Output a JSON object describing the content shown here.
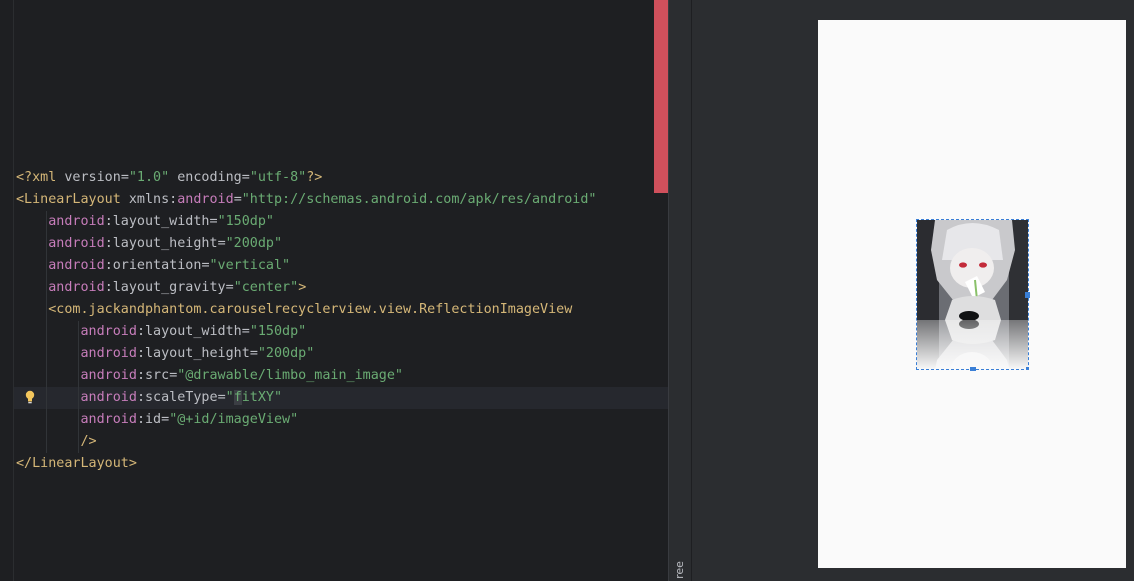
{
  "editor": {
    "lines": [
      [
        {
          "t": "<?xml ",
          "c": "tag"
        },
        {
          "t": "version",
          "c": "pl"
        },
        {
          "t": "=",
          "c": "pl"
        },
        {
          "t": "\"1.0\"",
          "c": "str"
        },
        {
          "t": " encoding",
          "c": "pl"
        },
        {
          "t": "=",
          "c": "pl"
        },
        {
          "t": "\"utf-8\"",
          "c": "str"
        },
        {
          "t": "?>",
          "c": "tag"
        }
      ],
      [
        {
          "t": "<LinearLayout ",
          "c": "tag"
        },
        {
          "t": "xmlns:",
          "c": "pl"
        },
        {
          "t": "android",
          "c": "ns"
        },
        {
          "t": "=",
          "c": "pl"
        },
        {
          "t": "\"http://schemas.android.com/apk/res/android\"",
          "c": "str"
        }
      ],
      [
        {
          "t": "    ",
          "c": "pl"
        },
        {
          "t": "android",
          "c": "ns"
        },
        {
          "t": ":layout_width",
          "c": "pl"
        },
        {
          "t": "=",
          "c": "pl"
        },
        {
          "t": "\"150dp\"",
          "c": "str"
        }
      ],
      [
        {
          "t": "    ",
          "c": "pl"
        },
        {
          "t": "android",
          "c": "ns"
        },
        {
          "t": ":layout_height",
          "c": "pl"
        },
        {
          "t": "=",
          "c": "pl"
        },
        {
          "t": "\"200dp\"",
          "c": "str"
        }
      ],
      [
        {
          "t": "    ",
          "c": "pl"
        },
        {
          "t": "android",
          "c": "ns"
        },
        {
          "t": ":orientation",
          "c": "pl"
        },
        {
          "t": "=",
          "c": "pl"
        },
        {
          "t": "\"vertical\"",
          "c": "str"
        }
      ],
      [
        {
          "t": "    ",
          "c": "pl"
        },
        {
          "t": "android",
          "c": "ns"
        },
        {
          "t": ":layout_gravity",
          "c": "pl"
        },
        {
          "t": "=",
          "c": "pl"
        },
        {
          "t": "\"center\"",
          "c": "str"
        },
        {
          "t": ">",
          "c": "tag"
        }
      ],
      [
        {
          "t": "    ",
          "c": "pl"
        },
        {
          "t": "<com.jackandphantom.carouselrecyclerview.view.ReflectionImageView",
          "c": "tag"
        }
      ],
      [
        {
          "t": "        ",
          "c": "pl"
        },
        {
          "t": "android",
          "c": "ns"
        },
        {
          "t": ":layout_width",
          "c": "pl"
        },
        {
          "t": "=",
          "c": "pl"
        },
        {
          "t": "\"150dp\"",
          "c": "str"
        }
      ],
      [
        {
          "t": "        ",
          "c": "pl"
        },
        {
          "t": "android",
          "c": "ns"
        },
        {
          "t": ":layout_height",
          "c": "pl"
        },
        {
          "t": "=",
          "c": "pl"
        },
        {
          "t": "\"200dp\"",
          "c": "str"
        }
      ],
      [
        {
          "t": "        ",
          "c": "pl"
        },
        {
          "t": "android",
          "c": "ns"
        },
        {
          "t": ":src",
          "c": "pl"
        },
        {
          "t": "=",
          "c": "pl"
        },
        {
          "t": "\"@drawable/limbo_main_image\"",
          "c": "str"
        }
      ],
      [
        {
          "t": "        ",
          "c": "pl"
        },
        {
          "t": "android",
          "c": "ns"
        },
        {
          "t": ":scaleType",
          "c": "pl"
        },
        {
          "t": "=",
          "c": "pl"
        },
        {
          "t": "\"",
          "c": "str"
        },
        {
          "t": "f",
          "c": "str caret-char"
        },
        {
          "t": "itXY\"",
          "c": "str"
        }
      ],
      [
        {
          "t": "        ",
          "c": "pl"
        },
        {
          "t": "android",
          "c": "ns"
        },
        {
          "t": ":id",
          "c": "pl"
        },
        {
          "t": "=",
          "c": "pl"
        },
        {
          "t": "\"@+id/imageView\"",
          "c": "str"
        }
      ],
      [
        {
          "t": "        ",
          "c": "pl"
        },
        {
          "t": "/>",
          "c": "tag"
        }
      ],
      [
        {
          "t": "</LinearLayout>",
          "c": "tag"
        }
      ]
    ]
  },
  "side_strip": {
    "label": "ree"
  },
  "colors": {
    "editor_bg": "#1e1f22",
    "tag": "#d5b778",
    "namespace": "#c77dbb",
    "string": "#6aab73",
    "plain": "#bcbec4",
    "error_marker": "#d0505c",
    "selection": "#3a7fd6"
  },
  "icons": {
    "gutter": "lightbulb-icon"
  }
}
